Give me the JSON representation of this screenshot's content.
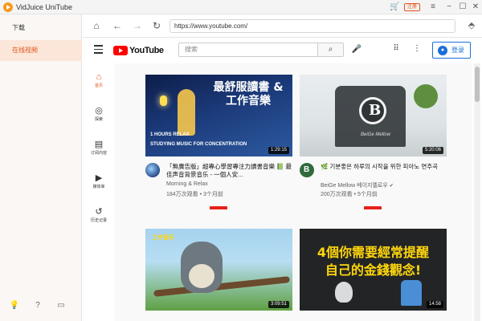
{
  "app": {
    "title": "VidJuice UniTube",
    "register_label": "注册",
    "menu": [
      "下载",
      "在线视频"
    ]
  },
  "browser": {
    "url": "https://www.youtube.com/"
  },
  "youtube": {
    "logo_text": "YouTube",
    "search_placeholder": "搜索",
    "signin_label": "登录",
    "sidebar": [
      {
        "label": "首页",
        "icon": "home-icon"
      },
      {
        "label": "探索",
        "icon": "compass-icon"
      },
      {
        "label": "订阅内容",
        "icon": "subscriptions-icon"
      },
      {
        "label": "媒体库",
        "icon": "library-icon"
      },
      {
        "label": "历史记录",
        "icon": "history-icon"
      }
    ],
    "videos": [
      {
        "thumb_title": "最舒服讀書 & 工作音樂",
        "thumb_sub1": "1 HOURS RELAX",
        "thumb_sub2": "STUDYING MUSIC FOR CONCENTRATION",
        "duration": "1:29:15",
        "title": "「無廣告版」超專心學習專注力讀書音樂 📗 最佳声音背景音乐 - 一個人安...",
        "channel": "Morning & Relax",
        "stats": "184万次观看 • 3个月前"
      },
      {
        "thumb_text": "BeiGe Mellow",
        "duration": "5:20:06",
        "title": "🌿 기분좋은 하루의 시작을 위한 피아노 연주곡",
        "channel": "BeiGe Mellow 베이지멜로우",
        "stats": "200万次观看 • 5个月前"
      },
      {
        "thumb_badge": "工作音乐",
        "duration": "3:09:51"
      },
      {
        "thumb_line1": "4個你需要經常提醒",
        "thumb_line2": "自己的金錢觀念!",
        "duration": "14:58"
      }
    ]
  },
  "colors": {
    "accent": "#e2541c",
    "youtube_red": "#ff0000",
    "signin_blue": "#1a6fd8"
  }
}
